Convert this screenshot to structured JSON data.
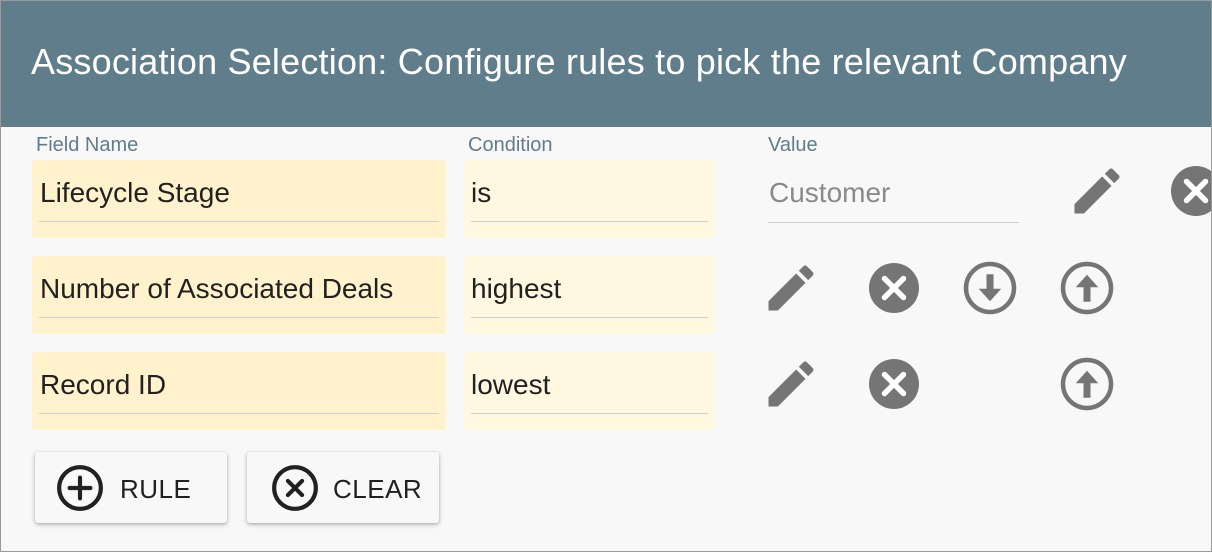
{
  "header": {
    "title": "Association Selection: Configure rules to pick the relevant Company"
  },
  "columns": {
    "field_name": "Field Name",
    "condition": "Condition",
    "value": "Value"
  },
  "rows": [
    {
      "field": "Lifecycle Stage",
      "condition": "is",
      "value": "Customer"
    },
    {
      "field": "Number of Associated Deals",
      "condition": "highest"
    },
    {
      "field": "Record ID",
      "condition": "lowest"
    }
  ],
  "buttons": {
    "add_rule": "RULE",
    "clear": "CLEAR"
  },
  "icons": {
    "edit": "pencil-icon",
    "remove": "close-circle-icon",
    "move_down": "arrow-down-circle-icon",
    "move_up": "arrow-up-circle-icon",
    "add": "plus-circle-icon",
    "clear": "close-circle-outline-icon"
  },
  "colors": {
    "header_bg": "#607d8b",
    "field_bg": "#fff2cc",
    "condition_bg": "#fff8e1",
    "icon_gray": "#757575"
  }
}
